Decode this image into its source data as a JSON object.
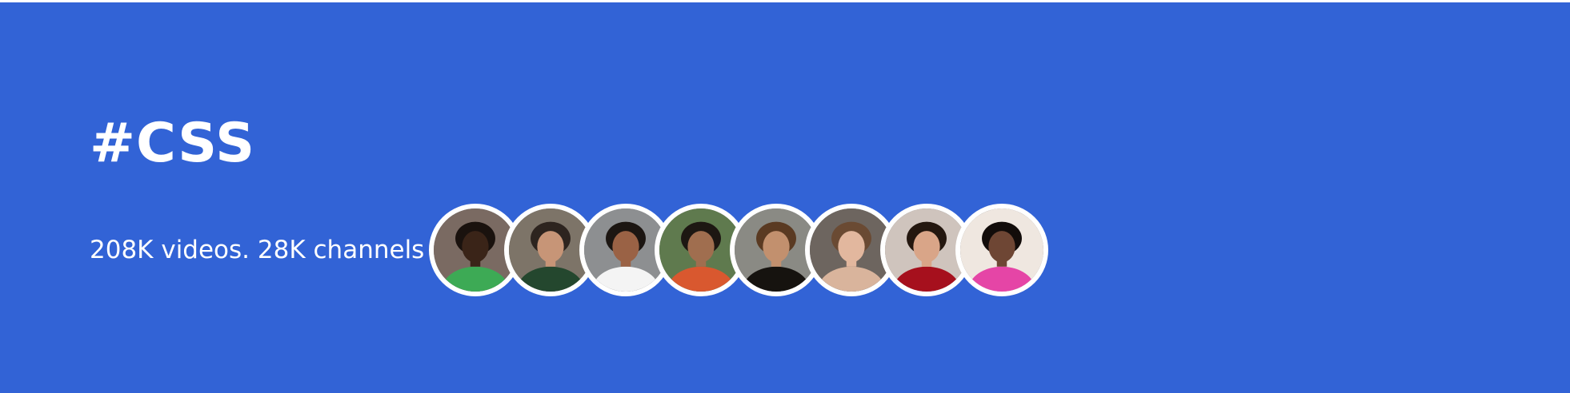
{
  "topic": {
    "title": "#CSS",
    "stats": "208K videos. 28K channels"
  },
  "avatars": [
    {
      "name": "person-1-icon",
      "bg": "#7a6a62",
      "skin": "#3a2418",
      "hair": "#1a120e",
      "shirt": "#3daa55"
    },
    {
      "name": "person-2-icon",
      "bg": "#7d7468",
      "skin": "#c79577",
      "hair": "#2d241f",
      "shirt": "#24472e"
    },
    {
      "name": "person-3-icon",
      "bg": "#8d8f91",
      "skin": "#9a6245",
      "hair": "#1c1612",
      "shirt": "#f4f4f4"
    },
    {
      "name": "person-4-icon",
      "bg": "#5f7a4e",
      "skin": "#a06e4f",
      "hair": "#1d1712",
      "shirt": "#d9582f"
    },
    {
      "name": "person-5-icon",
      "bg": "#8a8a84",
      "skin": "#c2906e",
      "hair": "#5a3a22",
      "shirt": "#16130f"
    },
    {
      "name": "person-6-icon",
      "bg": "#6d655f",
      "skin": "#e2b79e",
      "hair": "#6a4a33",
      "shirt": "#d9b49c"
    },
    {
      "name": "person-7-icon",
      "bg": "#cfc4bd",
      "skin": "#d9a588",
      "hair": "#24170f",
      "shirt": "#a6101d"
    },
    {
      "name": "person-8-icon",
      "bg": "#efe7e0",
      "skin": "#6e4634",
      "hair": "#120c0a",
      "shirt": "#e545a6"
    }
  ]
}
